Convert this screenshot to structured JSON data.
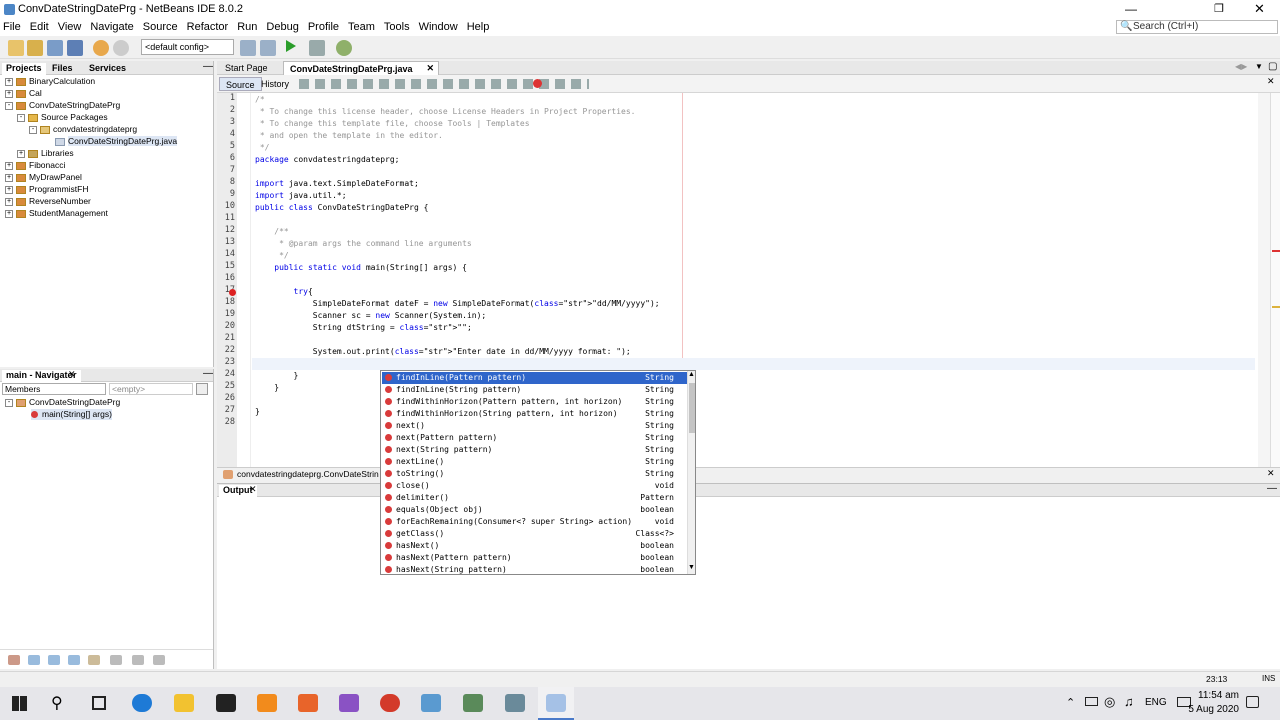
{
  "window": {
    "title": "ConvDateStringDatePrg - NetBeans IDE 8.0.2"
  },
  "menu": [
    "File",
    "Edit",
    "View",
    "Navigate",
    "Source",
    "Refactor",
    "Run",
    "Debug",
    "Profile",
    "Team",
    "Tools",
    "Window",
    "Help"
  ],
  "toolbar": {
    "config": "<default config>"
  },
  "search": {
    "placeholder": "Search (Ctrl+I)"
  },
  "projects": {
    "tabs": [
      "Projects",
      "Files",
      "Services"
    ],
    "items": [
      "BinaryCalculation",
      "Cal",
      "ConvDateStringDatePrg",
      "Source Packages",
      "convdatestringdateprg",
      "ConvDateStringDatePrg.java",
      "Libraries",
      "Fibonacci",
      "MyDrawPanel",
      "ProgrammistFH",
      "ReverseNumber",
      "StudentManagement"
    ]
  },
  "navigator": {
    "title": "main - Navigator",
    "members": "Members",
    "empty": "<empty>",
    "items": [
      "ConvDateStringDatePrg",
      "main(String[] args)"
    ]
  },
  "editor": {
    "tabs": [
      "Start Page",
      "ConvDateStringDatePrg.java"
    ],
    "subtabs": [
      "Source",
      "History"
    ],
    "breadcrumb": "convdatestringdateprg.ConvDateStrin",
    "lines": [
      "/*",
      " * To change this license header, choose License Headers in Project Properties.",
      " * To change this template file, choose Tools | Templates",
      " * and open the template in the editor.",
      " */",
      "package convdatestringdateprg;",
      "",
      "import java.text.SimpleDateFormat;",
      "import java.util.*;",
      "public class ConvDateStringDatePrg {",
      "",
      "    /**",
      "     * @param args the command line arguments",
      "     */",
      "    public static void main(String[] args) {",
      "",
      "        try{",
      "            SimpleDateFormat dateF = new SimpleDateFormat(\"dd/MM/yyyy\");",
      "            Scanner sc = new Scanner(System.in);",
      "            String dtString = \"\";",
      "",
      "            System.out.print(\"Enter date in dd/MM/yyyy format: \");",
      "            ",
      "        }",
      "    }",
      "",
      "}",
      ""
    ]
  },
  "autocomplete": {
    "items": [
      {
        "label": "findInLine(Pattern pattern)",
        "ret": "String"
      },
      {
        "label": "findInLine(String pattern)",
        "ret": "String"
      },
      {
        "label": "findWithinHorizon(Pattern pattern, int horizon)",
        "ret": "String"
      },
      {
        "label": "findWithinHorizon(String pattern, int horizon)",
        "ret": "String"
      },
      {
        "label": "next()",
        "ret": "String"
      },
      {
        "label": "next(Pattern pattern)",
        "ret": "String"
      },
      {
        "label": "next(String pattern)",
        "ret": "String"
      },
      {
        "label": "nextLine()",
        "ret": "String"
      },
      {
        "label": "toString()",
        "ret": "String"
      },
      {
        "label": "close()",
        "ret": "void"
      },
      {
        "label": "delimiter()",
        "ret": "Pattern"
      },
      {
        "label": "equals(Object obj)",
        "ret": "boolean"
      },
      {
        "label": "forEachRemaining(Consumer<? super String> action)",
        "ret": "void"
      },
      {
        "label": "getClass()",
        "ret": "Class<?>"
      },
      {
        "label": "hasNext()",
        "ret": "boolean"
      },
      {
        "label": "hasNext(Pattern pattern)",
        "ret": "boolean"
      },
      {
        "label": "hasNext(String pattern)",
        "ret": "boolean"
      }
    ]
  },
  "output": {
    "title": "Output"
  },
  "status": {
    "position": "23:13",
    "mode": "INS"
  },
  "taskbar": {
    "time": "11:54 am",
    "date": "5 Aug 2020",
    "lang": "ENG"
  }
}
